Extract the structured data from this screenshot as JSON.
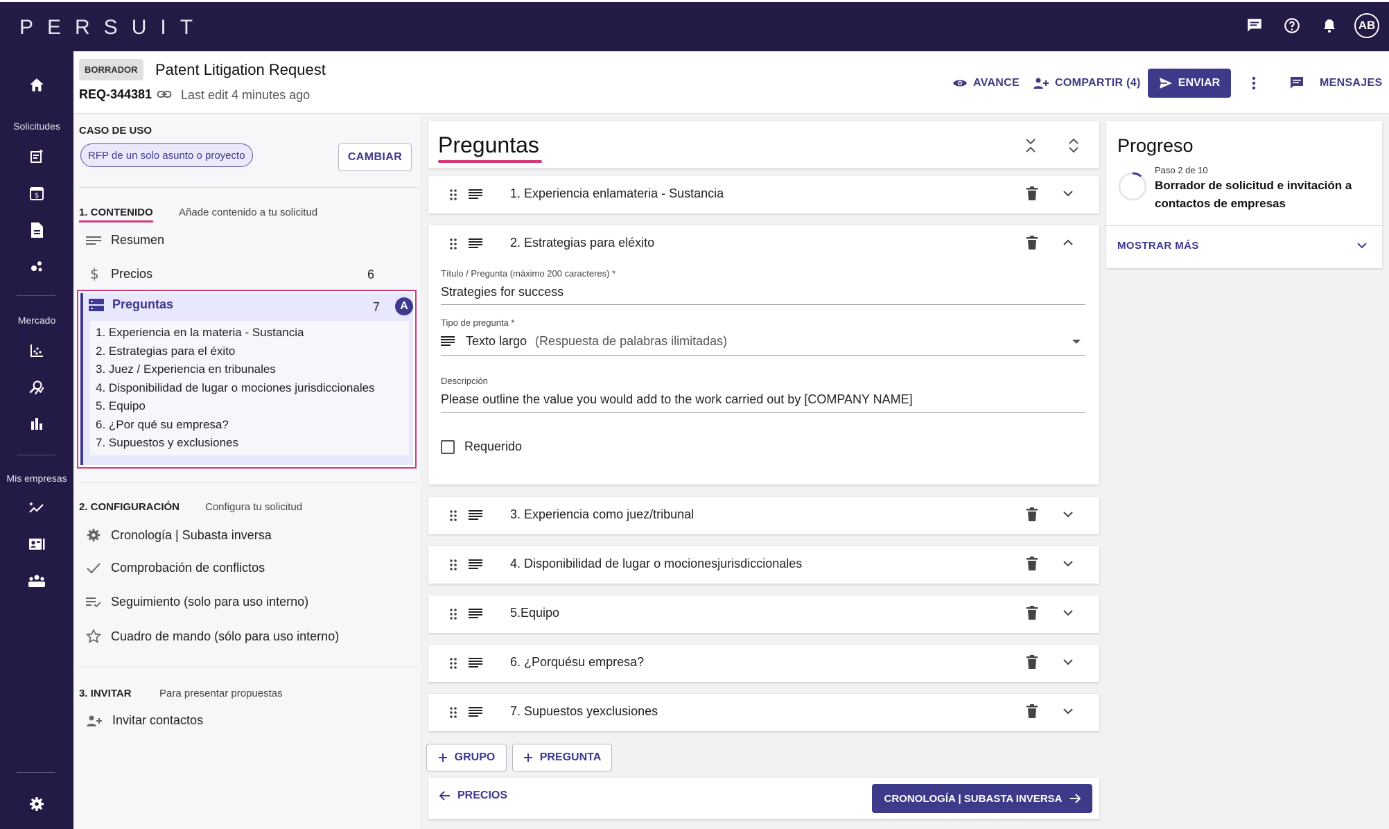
{
  "app": {
    "logo": "PERSUIT",
    "avatar_initials": "AB"
  },
  "rail": {
    "section_requests": "Solicitudes",
    "section_market": "Mercado",
    "section_firms": "Mis empresas"
  },
  "header": {
    "status_badge": "BORRADOR",
    "title": "Patent Litigation Request",
    "request_id": "REQ-344381",
    "last_edit": "Last edit 4 minutes ago",
    "preview_label": "AVANCE",
    "share_label": "COMPARTIR (4)",
    "send_label": "ENVIAR",
    "messages_label": "MENSAJES"
  },
  "left_panel": {
    "use_case_caption": "CASO DE USO",
    "use_case_chip": "RFP de un solo asunto o proyecto",
    "change_label": "CAMBIAR",
    "section1": {
      "title": "1. CONTENIDO",
      "subtitle": "Añade contenido a tu solicitud"
    },
    "summary_label": "Resumen",
    "pricing_label": "Precios",
    "pricing_count": "6",
    "questions_label": "Preguntas",
    "questions_count": "7",
    "questions_badge": "A",
    "questions_list": [
      "1. Experiencia en la materia - Sustancia",
      "2. Estrategias para el éxito",
      "3. Juez / Experiencia en tribunales",
      "4. Disponibilidad de lugar o mociones jurisdiccionales",
      "5. Equipo",
      "6. ¿Por qué su empresa?",
      "7. Supuestos y exclusiones"
    ],
    "section2": {
      "title": "2. CONFIGURACIÓN",
      "subtitle": "Configura tu solicitud"
    },
    "config_items": [
      "Cronología | Subasta inversa",
      "Comprobación de conflictos",
      "Seguimiento (solo para uso interno)",
      "Cuadro de mando (sólo para uso interno)"
    ],
    "section3": {
      "title": "3. INVITAR",
      "subtitle": "Para presentar propuestas"
    },
    "invite_label": "Invitar contactos"
  },
  "main": {
    "title": "Preguntas",
    "questions": [
      "1. Experiencia enlamateria - Sustancia",
      "2. Estrategias para eléxito",
      "3. Experiencia como juez/tribunal",
      "4. Disponibilidad de lugar o mocionesjurisdiccionales",
      "5.Equipo",
      "6. ¿Porquésu empresa?",
      "7. Supuestos yexclusiones"
    ],
    "editor": {
      "title_label": "Título / Pregunta (máximo 200 caracteres)  *",
      "title_value": "Strategies for success",
      "type_label": "Tipo de pregunta  *",
      "type_value": "Texto largo",
      "type_hint": "(Respuesta de palabras ilimitadas)",
      "description_label": "Descripción",
      "description_value": "Please outline the value you would add to the work carried out by [COMPANY NAME]",
      "required_label": "Requerido"
    },
    "add_group_label": "GRUPO",
    "add_question_label": "PREGUNTA",
    "prev_label": "PRECIOS",
    "next_label": "CRONOLOGÍA | SUBASTA INVERSA"
  },
  "progress": {
    "title": "Progreso",
    "step": "Paso 2 de 10",
    "description": "Borrador de solicitud e invitación a contactos de empresas",
    "show_more": "MOSTRAR MÁS"
  },
  "colors": {
    "nav": "#231b45",
    "accent": "#3d3890",
    "highlight": "#d23a7a"
  }
}
